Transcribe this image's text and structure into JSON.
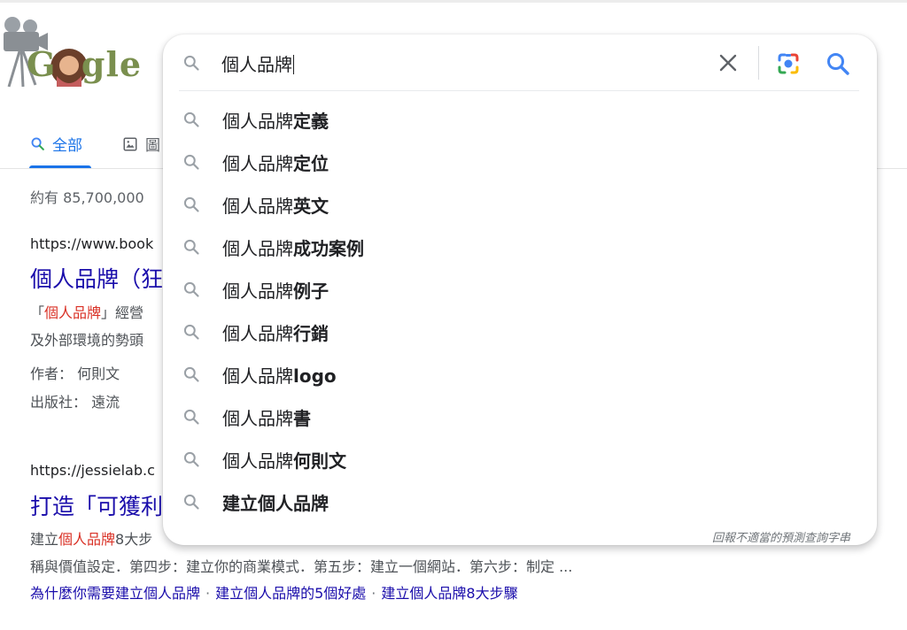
{
  "logo": {
    "letters": "G  gle"
  },
  "tabs": {
    "all_label": "全部",
    "images_label": "圖"
  },
  "result_stats": "約有 85,700,000",
  "result1": {
    "url": "https://www.book",
    "title": "個人品牌（狂",
    "snippet_pre": "「",
    "snippet_hl": "個人品牌",
    "snippet_post": "」經營",
    "snippet_line2": "及外部環境的勢頭",
    "author_label": "作者：",
    "author": "何則文",
    "publisher_label": "出版社：",
    "publisher": "遠流"
  },
  "result2": {
    "url": "https://jessielab.c",
    "title": "打造「可獲利",
    "snippet_pre": "建立",
    "snippet_hl": "個人品牌",
    "snippet_post": "8大步",
    "snippet_line2": "稱與價值設定．第四步：建立你的商業模式．第五步：建立一個網站．第六步：制定 ...",
    "links": [
      "為什麼你需要建立個人品牌",
      "建立個人品牌的5個好處",
      "建立個人品牌8大步驟"
    ],
    "link_sep": "·"
  },
  "search": {
    "query": "個人品牌",
    "suggestions": [
      {
        "prefix": "個人品牌",
        "bold": "定義"
      },
      {
        "prefix": "個人品牌",
        "bold": "定位"
      },
      {
        "prefix": "個人品牌",
        "bold": "英文"
      },
      {
        "prefix": "個人品牌",
        "bold": "成功案例"
      },
      {
        "prefix": "個人品牌",
        "bold": "例子"
      },
      {
        "prefix": "個人品牌",
        "bold": "行銷"
      },
      {
        "prefix": "個人品牌",
        "bold": "logo"
      },
      {
        "prefix": "個人品牌",
        "bold": "書"
      },
      {
        "prefix": "個人品牌",
        "bold": "何則文"
      },
      {
        "prefix": "",
        "bold": "建立個人品牌"
      }
    ],
    "report_label": "回報不適當的預測查詢字串"
  },
  "colors": {
    "link": "#1a0dab",
    "accent": "#1a73e8",
    "highlight": "#d93025"
  }
}
